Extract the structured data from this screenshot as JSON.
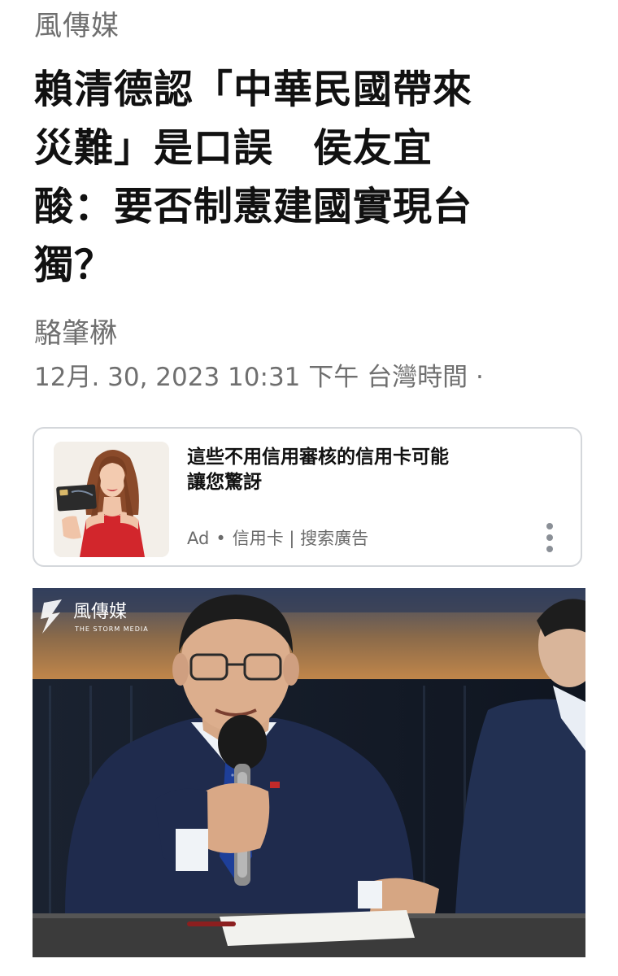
{
  "source": "風傳媒",
  "headline": {
    "lines": [
      "賴清德認「中華民國帶來",
      "災難」是口誤　侯友宜",
      "酸：要否制憲建國實現台",
      "獨？"
    ]
  },
  "author": "駱肇楙",
  "dateline": "12月. 30, 2023 10:31 下午 台灣時間 ·",
  "ad": {
    "title_lines": [
      "這些不用信用審核的信用卡可能",
      "讓您驚訝"
    ],
    "label": "Ad",
    "separator": "•",
    "sponsor": "信用卡 | 搜索廣告",
    "menu_icon": "kebab-menu-icon",
    "thumbnail_icon": "woman-holding-credit-card-image"
  },
  "photo": {
    "watermark_name": "風傳媒",
    "watermark_sub": "THE STORM MEDIA",
    "logo_icon": "storm-media-logo-icon"
  },
  "colors": {
    "meta_gray": "#6f6f6f",
    "card_border": "#d4d7db",
    "headline": "#111111"
  }
}
